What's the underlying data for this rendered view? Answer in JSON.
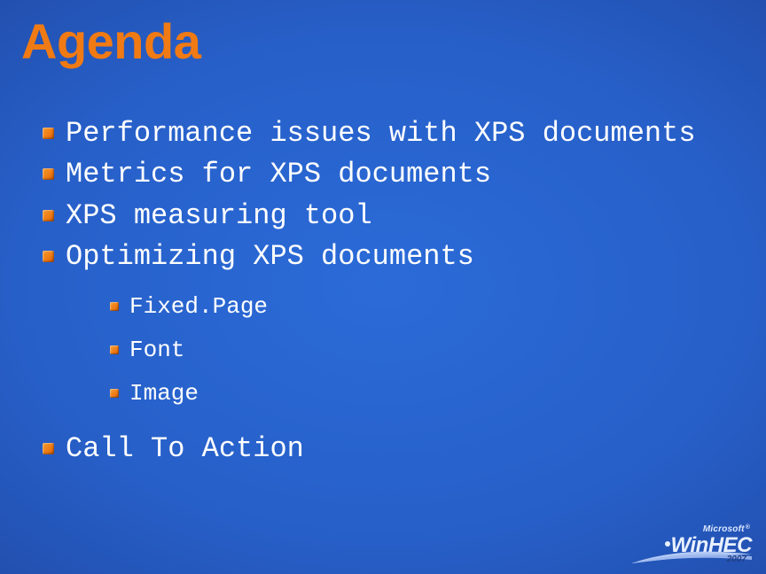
{
  "title": "Agenda",
  "items": [
    {
      "text": "Performance issues with XPS documents"
    },
    {
      "text": "Metrics for XPS documents"
    },
    {
      "text": "XPS measuring tool"
    },
    {
      "text": "Optimizing XPS documents",
      "children": [
        {
          "text": "Fixed.Page"
        },
        {
          "text": "Font"
        },
        {
          "text": "Image"
        }
      ]
    },
    {
      "text": "Call To Action"
    }
  ],
  "branding": {
    "company": "Microsoft",
    "event": "WinHEC",
    "year": "2007"
  },
  "colors": {
    "accent": "#f07a13",
    "background_center": "#2b6bd8",
    "background_edge": "#16316e"
  }
}
